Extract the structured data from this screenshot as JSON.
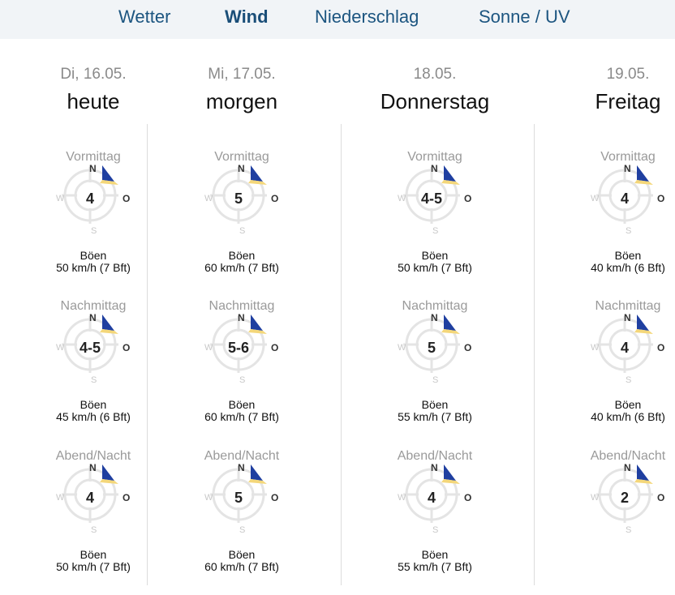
{
  "tabs": [
    {
      "label": "Wetter",
      "active": false
    },
    {
      "label": "Wind",
      "active": true
    },
    {
      "label": "Niederschlag",
      "active": false
    },
    {
      "label": "Sonne / UV",
      "active": false
    }
  ],
  "compass_labels": {
    "n": "N",
    "o": "O",
    "s": "S",
    "w": "W"
  },
  "gust_label": "Böen",
  "colors": {
    "arrow_blue": "#1f3fa0",
    "arrow_yellow": "#f4d77a",
    "tab_text": "#1c5580"
  },
  "days": [
    {
      "date": "Di, 16.05.",
      "name": "heute",
      "periods": [
        {
          "label": "Vormittag",
          "speed": "4",
          "gust": "50 km/h (7 Bft)"
        },
        {
          "label": "Nachmittag",
          "speed": "4-5",
          "gust": "45 km/h (6 Bft)"
        },
        {
          "label": "Abend/Nacht",
          "speed": "4",
          "gust": "50 km/h (7 Bft)"
        }
      ]
    },
    {
      "date": "Mi, 17.05.",
      "name": "morgen",
      "periods": [
        {
          "label": "Vormittag",
          "speed": "5",
          "gust": "60 km/h (7 Bft)"
        },
        {
          "label": "Nachmittag",
          "speed": "5-6",
          "gust": "60 km/h (7 Bft)"
        },
        {
          "label": "Abend/Nacht",
          "speed": "5",
          "gust": "60 km/h (7 Bft)"
        }
      ]
    },
    {
      "date": "18.05.",
      "name": "Donnerstag",
      "periods": [
        {
          "label": "Vormittag",
          "speed": "4-5",
          "gust": "50 km/h (7 Bft)"
        },
        {
          "label": "Nachmittag",
          "speed": "5",
          "gust": "55 km/h (7 Bft)"
        },
        {
          "label": "Abend/Nacht",
          "speed": "4",
          "gust": "55 km/h (7 Bft)"
        }
      ]
    },
    {
      "date": "19.05.",
      "name": "Freitag",
      "periods": [
        {
          "label": "Vormittag",
          "speed": "4",
          "gust": "40 km/h (6 Bft)"
        },
        {
          "label": "Nachmittag",
          "speed": "4",
          "gust": "40 km/h (6 Bft)"
        },
        {
          "label": "Abend/Nacht",
          "speed": "2",
          "gust": ""
        }
      ]
    }
  ]
}
